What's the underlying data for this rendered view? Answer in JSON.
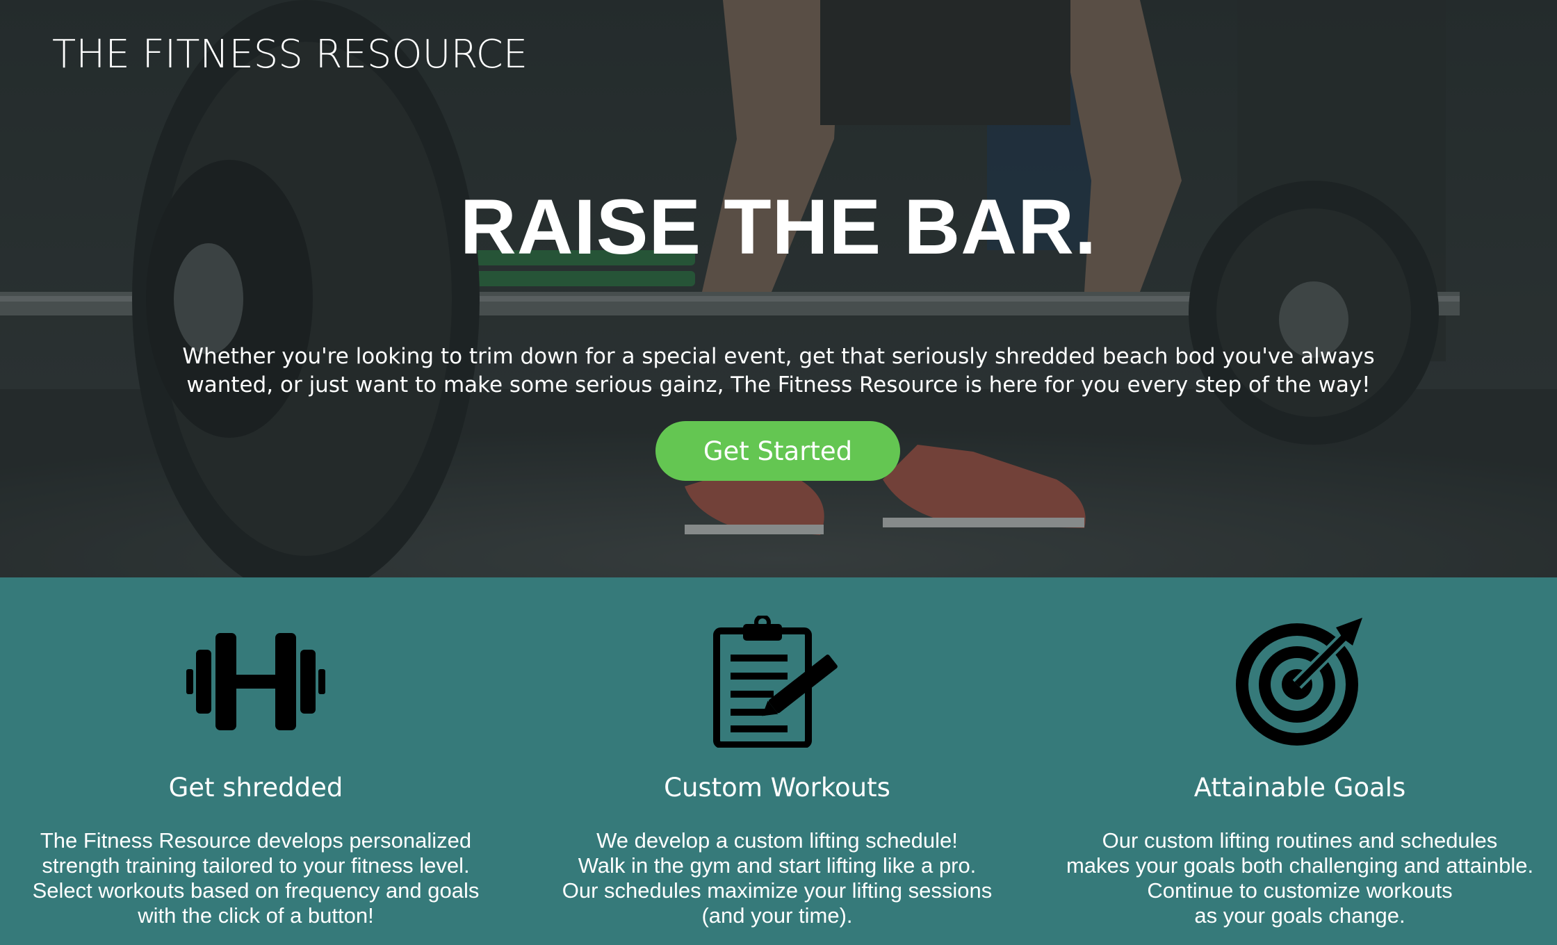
{
  "header": {
    "brand": "THE FITNESS RESOURCE"
  },
  "hero": {
    "headline": "RAISE THE BAR.",
    "subtext": "Whether you're looking to trim down for a special event, get that seriously shredded beach bod you've always wanted, or just want to make some serious gainz, The Fitness Resource is here for you every step of the way!",
    "cta_label": "Get Started",
    "background_image": "weightlifter-deadlift-photo"
  },
  "features": [
    {
      "icon": "dumbbell-icon",
      "title": "Get shredded",
      "body": "The Fitness Resource develops personalized\nstrength training tailored to your fitness level.\nSelect workouts based on frequency and goals\nwith the click of a button!"
    },
    {
      "icon": "clipboard-pencil-icon",
      "title": "Custom Workouts",
      "body": "We develop a custom lifting schedule!\nWalk in the gym and start lifting like a pro.\nOur schedules maximize your lifting sessions\n(and your time)."
    },
    {
      "icon": "target-arrow-icon",
      "title": "Attainable Goals",
      "body": "Our custom lifting routines and schedules\nmakes your goals both challenging and attainble.\nContinue to customize workouts\nas your goals change."
    }
  ],
  "colors": {
    "cta": "#64c652",
    "features_bg": "#367a7a",
    "text": "#ffffff",
    "icon": "#000000"
  }
}
